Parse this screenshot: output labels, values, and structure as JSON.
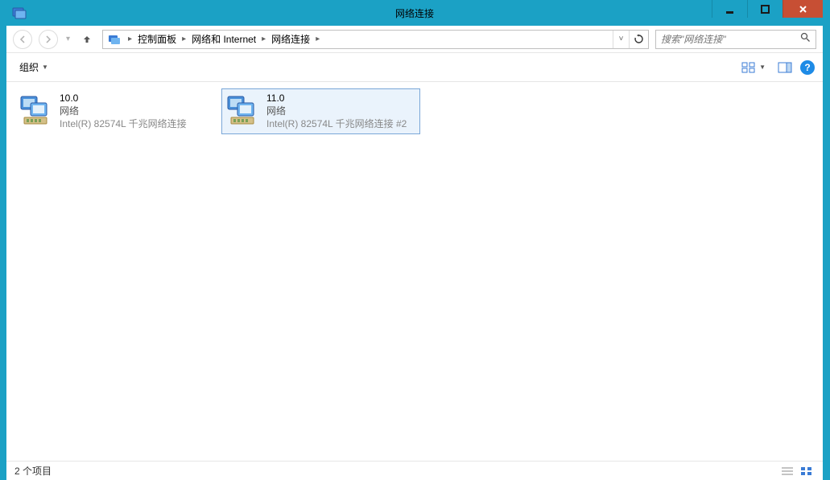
{
  "window": {
    "title": "网络连接"
  },
  "breadcrumbs": {
    "b0": "控制面板",
    "b1": "网络和 Internet",
    "b2": "网络连接"
  },
  "search": {
    "placeholder": "搜索\"网络连接\""
  },
  "toolbar": {
    "organize": "组织"
  },
  "items": {
    "i0": {
      "name": "10.0",
      "status": "网络",
      "adapter": "Intel(R) 82574L 千兆网络连接"
    },
    "i1": {
      "name": "11.0",
      "status": "网络",
      "adapter": "Intel(R) 82574L 千兆网络连接 #2"
    }
  },
  "status": {
    "count": "2 个项目"
  },
  "help": {
    "q": "?"
  }
}
